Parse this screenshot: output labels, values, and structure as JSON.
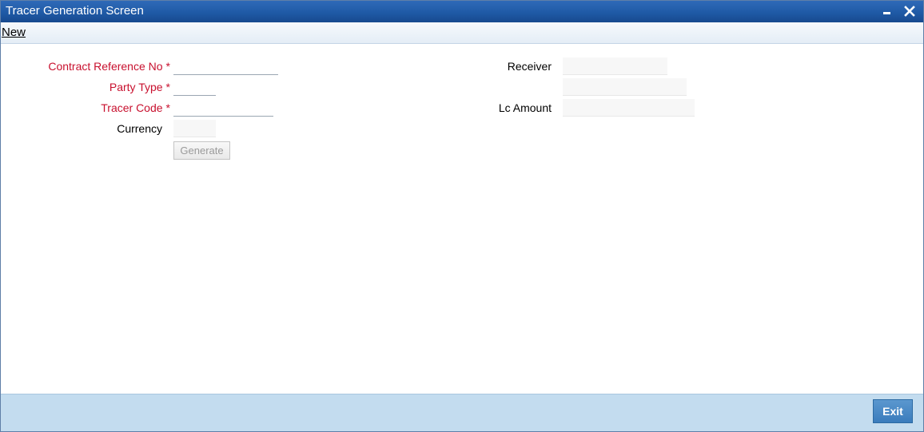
{
  "window": {
    "title": "Tracer Generation Screen",
    "minimize_icon": "minimize-icon",
    "close_icon": "close-icon"
  },
  "menu": {
    "new_label": "New"
  },
  "form": {
    "contract_reference_no": {
      "label": "Contract Reference No",
      "required": "*",
      "value": ""
    },
    "party_type": {
      "label": "Party Type",
      "required": "*",
      "value": ""
    },
    "tracer_code": {
      "label": "Tracer Code",
      "required": "*",
      "value": ""
    },
    "currency": {
      "label": "Currency",
      "value": ""
    },
    "generate_label": "Generate",
    "receiver": {
      "label": "Receiver",
      "value": "",
      "value2": ""
    },
    "lc_amount": {
      "label": "Lc Amount",
      "value": ""
    }
  },
  "footer": {
    "exit_label": "Exit"
  },
  "colors": {
    "titlebar": "#1f5aa6",
    "required_label": "#c8102e",
    "footer": "#c3dcef",
    "exit_button": "#3a7cbc"
  }
}
